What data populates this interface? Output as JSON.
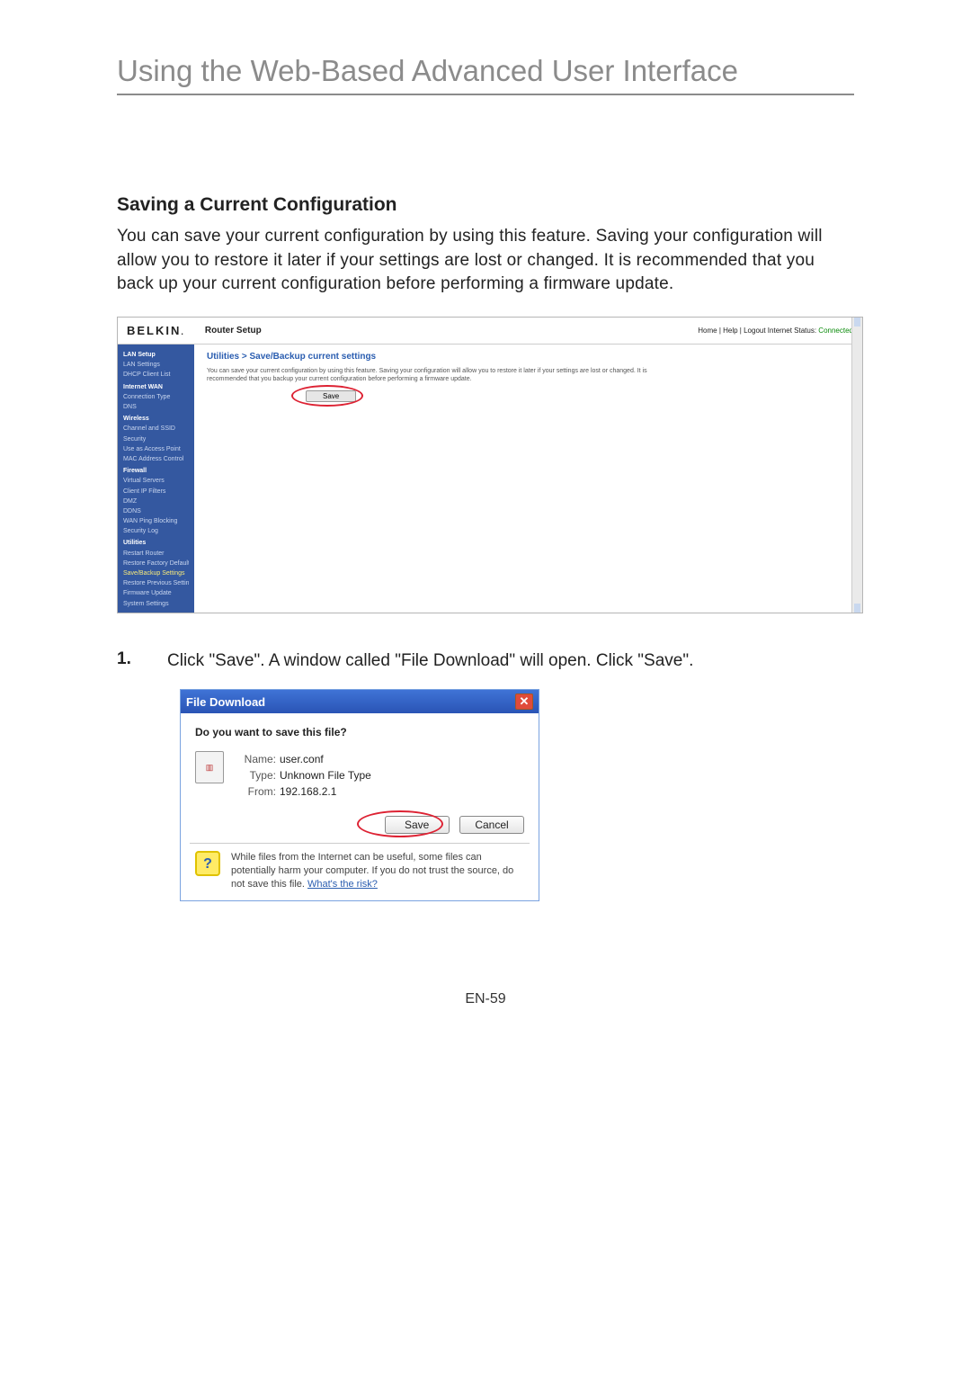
{
  "doc": {
    "title": "Using the Web-Based Advanced User Interface",
    "section_heading": "Saving a Current Configuration",
    "section_body": "You can save your current configuration by using this feature. Saving your configuration will allow you to restore it later if your settings are lost or changed. It is recommended that you back up your current configuration before performing a firmware update.",
    "step1_num": "1.",
    "step1_text": "Click \"Save\". A window called \"File Download\" will open. Click \"Save\".",
    "footer": "EN-59"
  },
  "router": {
    "logo": "BELKIN",
    "logo_sub": ".",
    "header_title": "Router Setup",
    "header_links": "Home | Help | Logout   Internet Status:",
    "status_value": "Connected",
    "breadcrumb": "Utilities > Save/Backup current settings",
    "desc": "You can save your current configuration by using this feature. Saving your configuration will allow you to restore it later if your settings are lost or changed. It is recommended that you backup your current configuration before performing a firmware update.",
    "save_label": "Save",
    "sidebar": [
      {
        "t": "LAN Setup",
        "cls": "cat"
      },
      {
        "t": "LAN Settings"
      },
      {
        "t": "DHCP Client List"
      },
      {
        "t": "Internet WAN",
        "cls": "cat"
      },
      {
        "t": "Connection Type"
      },
      {
        "t": "DNS"
      },
      {
        "t": "Wireless",
        "cls": "cat"
      },
      {
        "t": "Channel and SSID"
      },
      {
        "t": "Security"
      },
      {
        "t": "Use as Access Point"
      },
      {
        "t": "MAC Address Control"
      },
      {
        "t": "Firewall",
        "cls": "cat"
      },
      {
        "t": "Virtual Servers"
      },
      {
        "t": "Client IP Filters"
      },
      {
        "t": "DMZ"
      },
      {
        "t": "DDNS"
      },
      {
        "t": "WAN Ping Blocking"
      },
      {
        "t": "Security Log"
      },
      {
        "t": "Utilities",
        "cls": "cat"
      },
      {
        "t": "Restart Router"
      },
      {
        "t": "Restore Factory Default"
      },
      {
        "t": "Save/Backup Settings",
        "cls": "hl"
      },
      {
        "t": "Restore Previous Settings"
      },
      {
        "t": "Firmware Update"
      },
      {
        "t": "System Settings"
      }
    ]
  },
  "dialog": {
    "title": "File Download",
    "question": "Do you want to save this file?",
    "name_lbl": "Name:",
    "name_val": "user.conf",
    "type_lbl": "Type:",
    "type_val": "Unknown File Type",
    "from_lbl": "From:",
    "from_val": "192.168.2.1",
    "save_btn": "Save",
    "cancel_btn": "Cancel",
    "warn_text": "While files from the Internet can be useful, some files can potentially harm your computer. If you do not trust the source, do not save this file. ",
    "warn_link": "What's the risk?"
  }
}
